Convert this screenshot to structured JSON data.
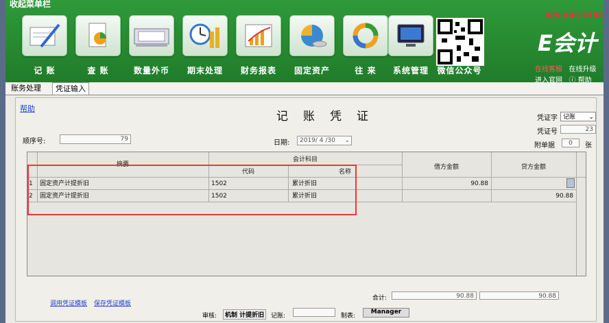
{
  "title_bar": "收起菜单栏",
  "toolbar": [
    {
      "label": "记 账",
      "icon": "pen-ledger-icon"
    },
    {
      "label": "查 账",
      "icon": "magnify-chart-icon"
    },
    {
      "label": "数量外币",
      "icon": "currency-icon"
    },
    {
      "label": "期末处理",
      "icon": "clock-coins-icon"
    },
    {
      "label": "财务报表",
      "icon": "bar-report-icon"
    },
    {
      "label": "固定资产",
      "icon": "assets-icon"
    },
    {
      "label": "往 来",
      "icon": "ring-icon"
    },
    {
      "label": "系统管理",
      "icon": "monitor-icon"
    },
    {
      "label": "微信公众号",
      "icon": "qr-code-icon"
    }
  ],
  "brand": {
    "phone": "400-600-6185",
    "name": "E会计",
    "links": [
      "在线客服",
      "在线升级",
      "进入官网",
      "帮助"
    ]
  },
  "tabs": [
    "账务处理",
    "凭证输入"
  ],
  "voucher": {
    "help": "帮助",
    "title": "记账凭证",
    "seq_label": "顺序号:",
    "seq_value": "79",
    "date_label": "日期:",
    "date_value": "2019/ 4 /30",
    "type_label": "凭证字",
    "type_value": "记账",
    "no_label": "凭证号",
    "no_value": "23",
    "attach_label": "附单据",
    "attach_value": "0",
    "attach_unit": "张",
    "headers": {
      "summary": "摘要",
      "account": "会计科目",
      "code": "代码",
      "name": "名称",
      "debit": "借方金额",
      "credit": "贷方金额"
    },
    "rows": [
      {
        "no": "1",
        "summary": "固定资产计提折旧",
        "code": "1502",
        "name": "累计折旧",
        "debit": "90.88",
        "credit": ""
      },
      {
        "no": "2",
        "summary": "固定资产计提折旧",
        "code": "1502",
        "name": "累计折旧",
        "debit": "",
        "credit": "90.88"
      }
    ],
    "footer": {
      "template_load": "调用凭证模板",
      "template_save": "保存凭证模板",
      "total_label": "合计:",
      "total_debit": "90.88",
      "total_credit": "90.88",
      "audit_label": "审核:",
      "maker_value": "机制",
      "maker_value2": "计提折旧",
      "book_label": "记账:",
      "creator_label": "制表:",
      "creator_value": "Manager"
    }
  }
}
